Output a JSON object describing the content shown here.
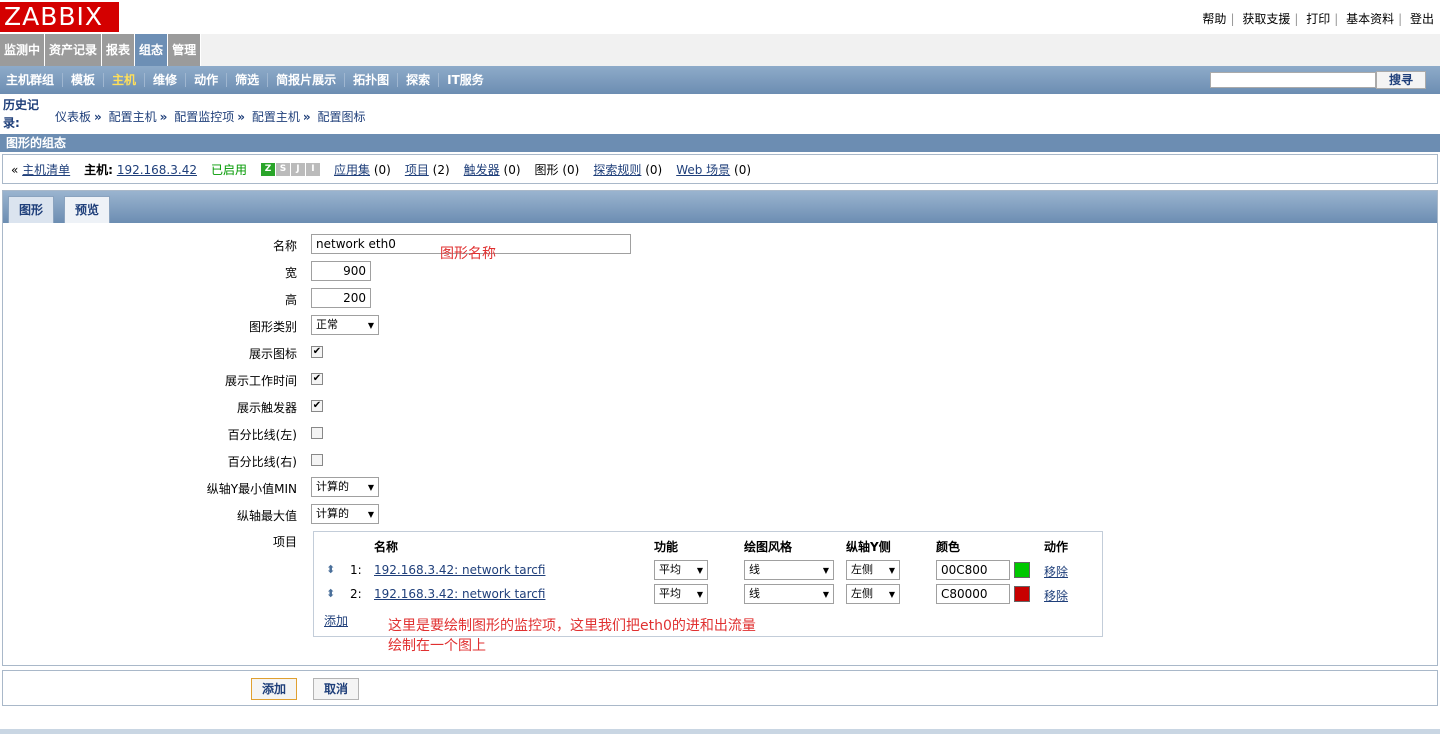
{
  "header": {
    "logo": "ZABBIX",
    "links": [
      "帮助",
      "获取支援",
      "打印",
      "基本资料",
      "登出"
    ]
  },
  "main_menu": [
    {
      "label": "监测中",
      "active": false
    },
    {
      "label": "资产记录",
      "active": false
    },
    {
      "label": "报表",
      "active": false
    },
    {
      "label": "组态",
      "active": true
    },
    {
      "label": "管理",
      "active": false
    }
  ],
  "sub_menu": [
    {
      "label": "主机群组",
      "active": false
    },
    {
      "label": "模板",
      "active": false
    },
    {
      "label": "主机",
      "active": true
    },
    {
      "label": "维修",
      "active": false
    },
    {
      "label": "动作",
      "active": false
    },
    {
      "label": "筛选",
      "active": false
    },
    {
      "label": "简报片展示",
      "active": false
    },
    {
      "label": "拓扑图",
      "active": false
    },
    {
      "label": "探索",
      "active": false
    },
    {
      "label": "IT服务",
      "active": false
    }
  ],
  "search": {
    "button": "搜寻",
    "value": ""
  },
  "history": {
    "label": "历史记录:",
    "crumbs": [
      "仪表板",
      "配置主机",
      "配置监控项",
      "配置主机",
      "配置图标"
    ]
  },
  "section_title": "图形的组态",
  "hostbar": {
    "back": "主机清单",
    "host_label": "主机:",
    "host": "192.168.3.42",
    "status": "已启用",
    "availability": [
      "Z",
      "S",
      "J",
      "I"
    ],
    "app_label": "应用集",
    "app_count": "(0)",
    "items_label": "项目",
    "items_count": "(2)",
    "triggers_label": "触发器",
    "triggers_count": "(0)",
    "graphs_label": "图形",
    "graphs_count": "(0)",
    "discovery_label": "探索规则",
    "discovery_count": "(0)",
    "web_label": "Web 场景",
    "web_count": "(0)"
  },
  "tabs": [
    {
      "label": "图形",
      "active": true
    },
    {
      "label": "预览",
      "active": false
    }
  ],
  "form": {
    "name_label": "名称",
    "name_value": "network eth0",
    "width_label": "宽",
    "width_value": "900",
    "height_label": "高",
    "height_value": "200",
    "type_label": "图形类别",
    "type_value": "正常",
    "show_legend_label": "展示图标",
    "show_legend": true,
    "show_worktime_label": "展示工作时间",
    "show_worktime": true,
    "show_triggers_label": "展示触发器",
    "show_triggers": true,
    "percent_left_label": "百分比线(左)",
    "percent_left": false,
    "percent_right_label": "百分比线(右)",
    "percent_right": false,
    "ymin_label": "纵轴Y最小值MIN",
    "ymin_value": "计算的",
    "ymax_label": "纵轴最大值",
    "ymax_value": "计算的",
    "items_label": "项目"
  },
  "items_table": {
    "headers": {
      "name": "名称",
      "function": "功能",
      "style": "绘图风格",
      "yaxis": "纵轴Y侧",
      "color": "颜色",
      "action": "动作"
    },
    "rows": [
      {
        "idx": "1:",
        "name": "192.168.3.42: network tarcfi",
        "function": "平均",
        "style": "线",
        "yaxis": "左侧",
        "color": "00C800",
        "swatch": "#00c800",
        "action": "移除"
      },
      {
        "idx": "2:",
        "name": "192.168.3.42: network tarcfi",
        "function": "平均",
        "style": "线",
        "yaxis": "左侧",
        "color": "C80000",
        "swatch": "#c80000",
        "action": "移除"
      }
    ],
    "add": "添加"
  },
  "annotations": {
    "name_note": "图形名称",
    "items_note_line1": "这里是要绘制图形的监控项，这里我们把eth0的进和出流量",
    "items_note_line2": "绘制在一个图上"
  },
  "buttons": {
    "add": "添加",
    "cancel": "取消"
  }
}
